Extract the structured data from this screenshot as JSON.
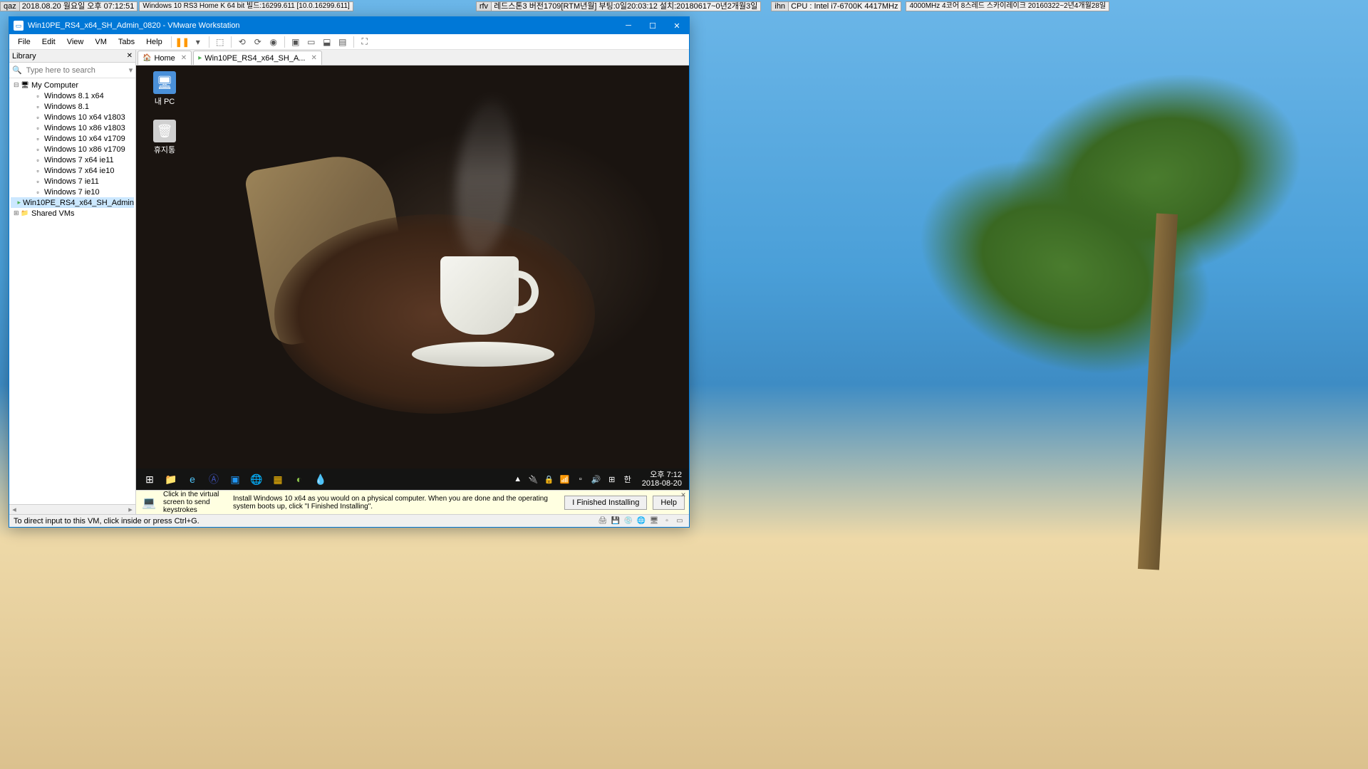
{
  "monitors": {
    "qaz": {
      "label": "qaz",
      "text": "2018.08.20 월요일 오후 07:12:51"
    },
    "win": {
      "text": "Windows 10 RS3 Home K 64 bit 빌드:16299.611 [10.0.16299.611]"
    },
    "rfv": {
      "label": "rfv",
      "text": "레드스톤3 버전1709[RTM년월] 부팅:0일20:03:12 설치:20180617~0년2개월3일"
    },
    "ihn": {
      "label": "ihn",
      "text": "CPU : Intel i7-6700K 4417MHz"
    },
    "last": {
      "text": "4000MHz 4코어 8스레드 스카이레이크 20160322~2년4개월28일"
    }
  },
  "window": {
    "title": "Win10PE_RS4_x64_SH_Admin_0820 - VMware Workstation"
  },
  "menus": [
    "File",
    "Edit",
    "View",
    "VM",
    "Tabs",
    "Help"
  ],
  "library": {
    "title": "Library",
    "search_placeholder": "Type here to search",
    "root": "My Computer",
    "vms": [
      "Windows 8.1 x64",
      "Windows 8.1",
      "Windows 10 x64 v1803",
      "Windows 10 x86 v1803",
      "Windows 10 x64 v1709",
      "Windows 10 x86 v1709",
      "Windows 7 x64 ie11",
      "Windows 7 x64 ie10",
      "Windows 7 ie11",
      "Windows 7 ie10",
      "Win10PE_RS4_x64_SH_Admin"
    ],
    "shared": "Shared VMs"
  },
  "tabs": {
    "home": "Home",
    "vm": "Win10PE_RS4_x64_SH_A..."
  },
  "vm_desktop": {
    "mypc": "내 PC",
    "recycle": "휴지통"
  },
  "vm_clock": {
    "time": "오후 7:12",
    "date": "2018-08-20"
  },
  "hint": {
    "text1": "Click in the virtual screen to send keystrokes",
    "text2": "Install Windows 10 x64 as you would on a physical computer. When you are done and the operating system boots up, click \"I Finished Installing\".",
    "btn1": "I Finished Installing",
    "btn2": "Help"
  },
  "status": "To direct input to this VM, click inside or press Ctrl+G."
}
